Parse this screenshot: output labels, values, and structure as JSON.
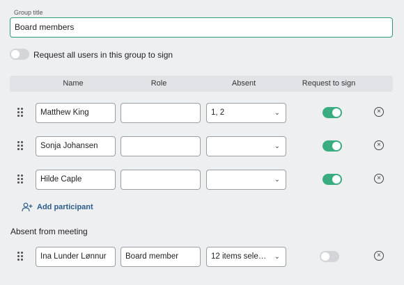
{
  "group": {
    "label": "Group title",
    "value": "Board members"
  },
  "request_all": {
    "label": "Request all users in this group to sign",
    "on": false
  },
  "columns": [
    "Name",
    "Role",
    "Absent",
    "Request to sign"
  ],
  "participants": [
    {
      "name": "Matthew King",
      "role": "",
      "absent": "1, 2",
      "sign": true
    },
    {
      "name": "Sonja Johansen",
      "role": "",
      "absent": "",
      "sign": true
    },
    {
      "name": "Hilde Caple",
      "role": "",
      "absent": "",
      "sign": true
    }
  ],
  "add_participant_label": "Add participant",
  "absent_section": {
    "heading": "Absent from meeting",
    "rows": [
      {
        "name": "Ina Lunder Lønnur",
        "role": "Board member",
        "absent": "12 items selected",
        "sign": false
      }
    ]
  },
  "colors": {
    "accent": "#3aad80",
    "link": "#2c5d8a",
    "focus_border": "#2f9a7c"
  },
  "icons": {
    "drag": "drag-handle-icon",
    "remove": "remove-circle-icon",
    "add": "add-person-icon",
    "chevron": "chevron-down-icon"
  }
}
